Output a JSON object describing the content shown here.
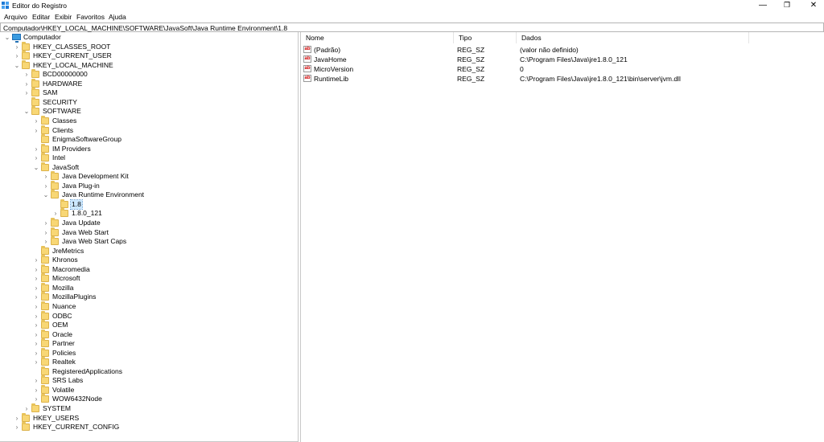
{
  "window": {
    "title": "Editor do Registro",
    "minimize": "—",
    "maximize": "❐",
    "close": "✕"
  },
  "menu": [
    "Arquivo",
    "Editar",
    "Exibir",
    "Favoritos",
    "Ajuda"
  ],
  "address": "Computador\\HKEY_LOCAL_MACHINE\\SOFTWARE\\JavaSoft\\Java Runtime Environment\\1.8",
  "tree": [
    {
      "label": "Computador",
      "depth": 0,
      "state": "expanded",
      "icon": "computer-icon"
    },
    {
      "label": "HKEY_CLASSES_ROOT",
      "depth": 1,
      "state": "collapsed"
    },
    {
      "label": "HKEY_CURRENT_USER",
      "depth": 1,
      "state": "collapsed"
    },
    {
      "label": "HKEY_LOCAL_MACHINE",
      "depth": 1,
      "state": "expanded"
    },
    {
      "label": "BCD00000000",
      "depth": 2,
      "state": "collapsed"
    },
    {
      "label": "HARDWARE",
      "depth": 2,
      "state": "collapsed"
    },
    {
      "label": "SAM",
      "depth": 2,
      "state": "collapsed"
    },
    {
      "label": "SECURITY",
      "depth": 2,
      "state": "leaf"
    },
    {
      "label": "SOFTWARE",
      "depth": 2,
      "state": "expanded"
    },
    {
      "label": "Classes",
      "depth": 3,
      "state": "collapsed"
    },
    {
      "label": "Clients",
      "depth": 3,
      "state": "collapsed"
    },
    {
      "label": "EnigmaSoftwareGroup",
      "depth": 3,
      "state": "leaf"
    },
    {
      "label": "IM Providers",
      "depth": 3,
      "state": "collapsed"
    },
    {
      "label": "Intel",
      "depth": 3,
      "state": "collapsed"
    },
    {
      "label": "JavaSoft",
      "depth": 3,
      "state": "expanded"
    },
    {
      "label": "Java Development Kit",
      "depth": 4,
      "state": "collapsed"
    },
    {
      "label": "Java Plug-in",
      "depth": 4,
      "state": "collapsed"
    },
    {
      "label": "Java Runtime Environment",
      "depth": 4,
      "state": "expanded"
    },
    {
      "label": "1.8",
      "depth": 5,
      "state": "leaf",
      "selected": true
    },
    {
      "label": "1.8.0_121",
      "depth": 5,
      "state": "collapsed"
    },
    {
      "label": "Java Update",
      "depth": 4,
      "state": "collapsed"
    },
    {
      "label": "Java Web Start",
      "depth": 4,
      "state": "collapsed"
    },
    {
      "label": "Java Web Start Caps",
      "depth": 4,
      "state": "collapsed"
    },
    {
      "label": "JreMetrics",
      "depth": 3,
      "state": "leaf"
    },
    {
      "label": "Khronos",
      "depth": 3,
      "state": "collapsed"
    },
    {
      "label": "Macromedia",
      "depth": 3,
      "state": "collapsed"
    },
    {
      "label": "Microsoft",
      "depth": 3,
      "state": "collapsed"
    },
    {
      "label": "Mozilla",
      "depth": 3,
      "state": "collapsed"
    },
    {
      "label": "MozillaPlugins",
      "depth": 3,
      "state": "collapsed"
    },
    {
      "label": "Nuance",
      "depth": 3,
      "state": "collapsed"
    },
    {
      "label": "ODBC",
      "depth": 3,
      "state": "collapsed"
    },
    {
      "label": "OEM",
      "depth": 3,
      "state": "collapsed"
    },
    {
      "label": "Oracle",
      "depth": 3,
      "state": "collapsed"
    },
    {
      "label": "Partner",
      "depth": 3,
      "state": "collapsed"
    },
    {
      "label": "Policies",
      "depth": 3,
      "state": "collapsed"
    },
    {
      "label": "Realtek",
      "depth": 3,
      "state": "collapsed"
    },
    {
      "label": "RegisteredApplications",
      "depth": 3,
      "state": "leaf"
    },
    {
      "label": "SRS Labs",
      "depth": 3,
      "state": "collapsed"
    },
    {
      "label": "Volatile",
      "depth": 3,
      "state": "collapsed"
    },
    {
      "label": "WOW6432Node",
      "depth": 3,
      "state": "collapsed"
    },
    {
      "label": "SYSTEM",
      "depth": 2,
      "state": "collapsed"
    },
    {
      "label": "HKEY_USERS",
      "depth": 1,
      "state": "collapsed"
    },
    {
      "label": "HKEY_CURRENT_CONFIG",
      "depth": 1,
      "state": "collapsed"
    }
  ],
  "columns": {
    "name": "Nome",
    "type": "Tipo",
    "data": "Dados"
  },
  "values": [
    {
      "name": "(Padrão)",
      "type": "REG_SZ",
      "data": "(valor não definido)"
    },
    {
      "name": "JavaHome",
      "type": "REG_SZ",
      "data": "C:\\Program Files\\Java\\jre1.8.0_121"
    },
    {
      "name": "MicroVersion",
      "type": "REG_SZ",
      "data": "0"
    },
    {
      "name": "RuntimeLib",
      "type": "REG_SZ",
      "data": "C:\\Program Files\\Java\\jre1.8.0_121\\bin\\server\\jvm.dll"
    }
  ],
  "value_icon_text": "ab"
}
